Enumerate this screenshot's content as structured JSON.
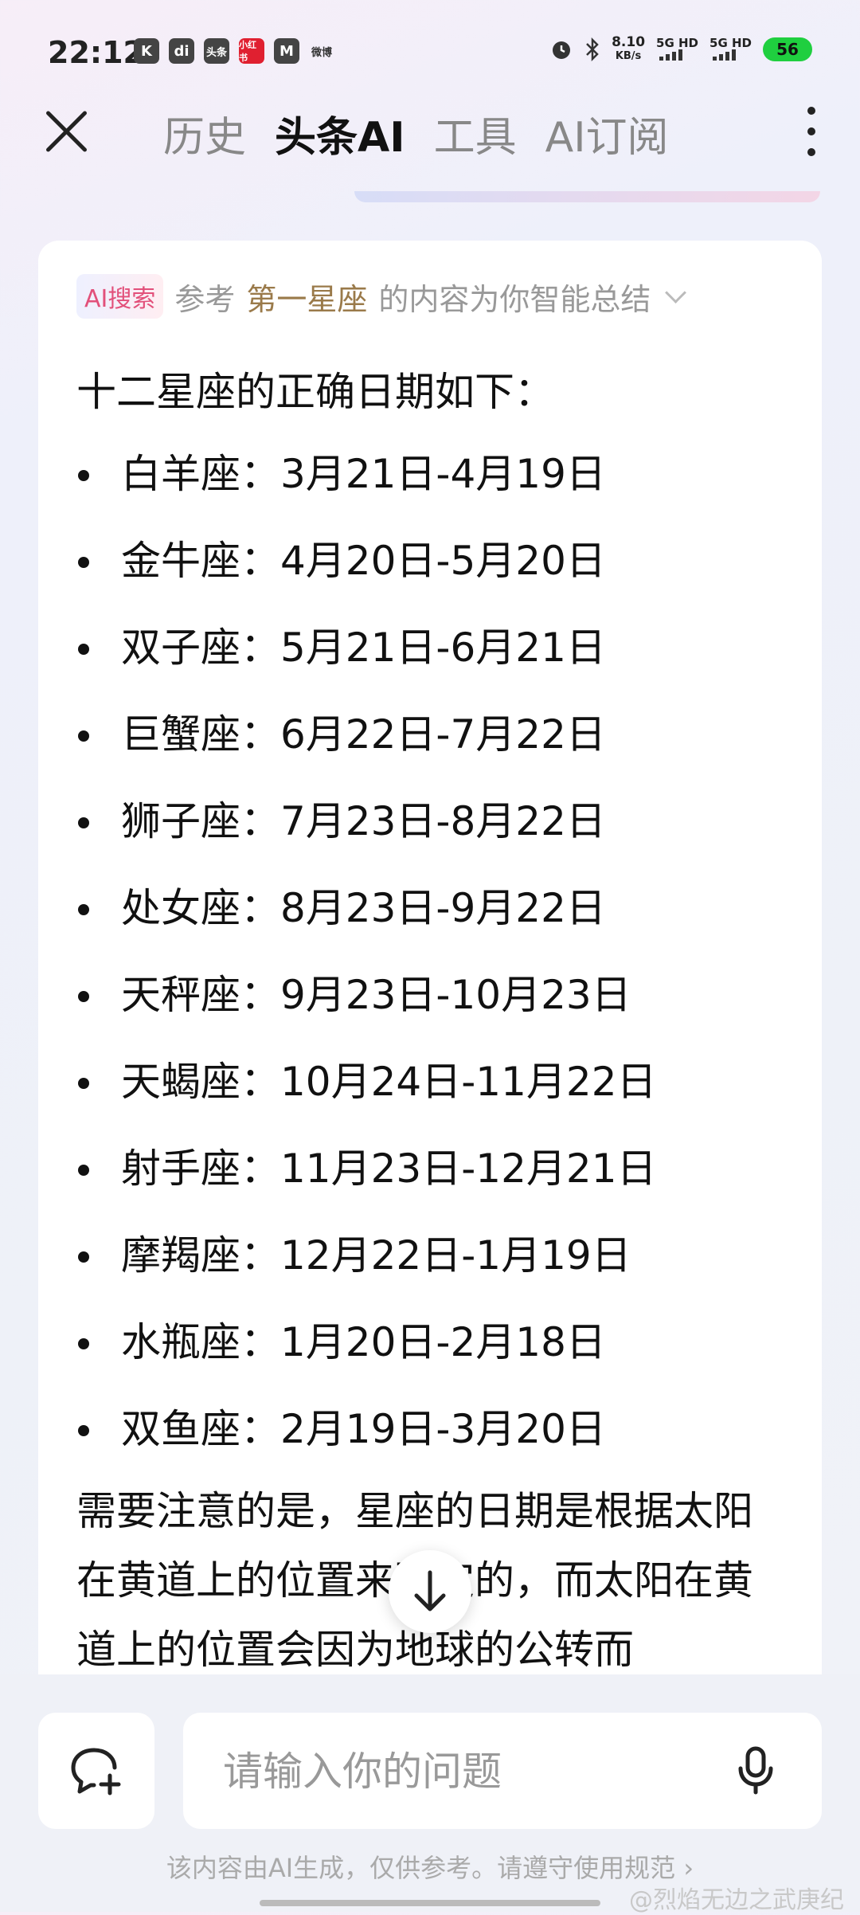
{
  "status_bar": {
    "time": "22:12",
    "app_icons": [
      "K",
      "di",
      "头条",
      "小红书",
      "M",
      "微博"
    ],
    "net_speed_value": "8.10",
    "net_speed_unit": "KB/s",
    "signal1": "5G HD",
    "signal2": "5G HD",
    "battery": "56",
    "battery_color": "#1fcf3f"
  },
  "header": {
    "tabs": [
      "历史",
      "头条AI",
      "工具",
      "AI订阅"
    ],
    "active_tab": "头条AI"
  },
  "source": {
    "badge": "AI搜索",
    "prefix": "参考",
    "link": "第一星座",
    "suffix": "的内容为你智能总结"
  },
  "answer": {
    "intro": "十二星座的正确日期如下：",
    "items": [
      "白羊座：3月21日-4月19日",
      "金牛座：4月20日-5月20日",
      "双子座：5月21日-6月21日",
      "巨蟹座：6月22日-7月22日",
      "狮子座：7月23日-8月22日",
      "处女座：8月23日-9月22日",
      "天秤座：9月23日-10月23日",
      "天蝎座：10月24日-11月22日",
      "射手座：11月23日-12月21日",
      "摩羯座：12月22日-1月19日",
      "水瓶座：1月20日-2月18日",
      "双鱼座：2月19日-3月20日"
    ],
    "note": "需要注意的是，星座的日期是根据太阳在黄道上的位置来确定的，而太阳在黄道上的位置会因为地球的公转而"
  },
  "input": {
    "placeholder": "请输入你的问题"
  },
  "footer": {
    "disclaimer": "该内容由AI生成，仅供参考。请遵守使用规范",
    "disclaimer_chevron": "›",
    "watermark": "@烈焰无边之武庚纪"
  },
  "colors": {
    "accent_link": "#9a7a4a",
    "badge_text": "#e2507a"
  }
}
